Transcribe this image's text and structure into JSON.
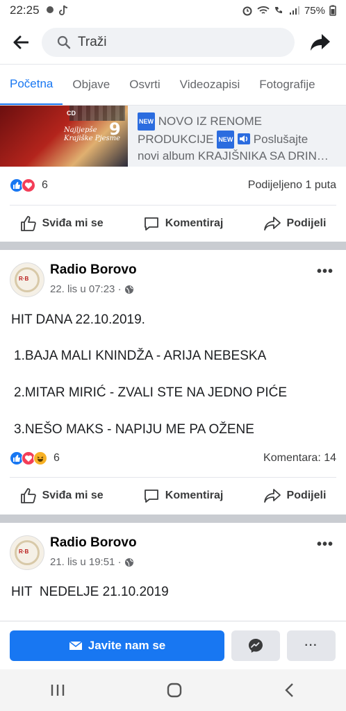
{
  "status_bar": {
    "time": "22:25",
    "battery": "75%"
  },
  "header": {
    "search_placeholder": "Traži"
  },
  "tabs": [
    {
      "label": "Početna",
      "active": true
    },
    {
      "label": "Objave",
      "active": false
    },
    {
      "label": "Osvrti",
      "active": false
    },
    {
      "label": "Videozapisi",
      "active": false
    },
    {
      "label": "Fotografije",
      "active": false
    }
  ],
  "post1": {
    "thumb_cd": "CD",
    "thumb_title_line1": "Najljepše",
    "thumb_title_line2": "Krajiške Pjesme",
    "thumb_number": "9",
    "new_badge": "NEW",
    "link_text_a": "NOVO IZ RENOME",
    "link_text_b": "PRODUKCIJE",
    "link_text_c": "Poslušajte",
    "link_text_d": "novi album KRAJIŠNIKA SA DRIN…",
    "reaction_count": "6",
    "shared": "Podijeljeno 1 puta"
  },
  "actions": {
    "like": "Sviđa mi se",
    "comment": "Komentiraj",
    "share": "Podijeli"
  },
  "post2": {
    "page_name": "Radio Borovo",
    "meta": "22. lis u 07:23 ·",
    "line1": "HIT DANA 22.10.2019.",
    "line2": "1.BAJA MALI KNINDŽA - ARIJA NEBESKA",
    "line3": "2.MITAR MIRIĆ - ZVALI STE NA JEDNO PIĆE",
    "line4": "3.NEŠO MAKS - NAPIJU ME PA OŽENE",
    "reaction_count": "6",
    "comments": "Komentara: 14"
  },
  "post3": {
    "page_name": "Radio Borovo",
    "meta": "21. lis u 19:51 ·",
    "line1": "HIT  NEDELJE 21.10.2019"
  },
  "bottom_bar": {
    "contact_label": "Javite nam se",
    "more_label": "···"
  },
  "colors": {
    "accent": "#1877f2",
    "love": "#f33e58",
    "haha": "#f7b125"
  }
}
